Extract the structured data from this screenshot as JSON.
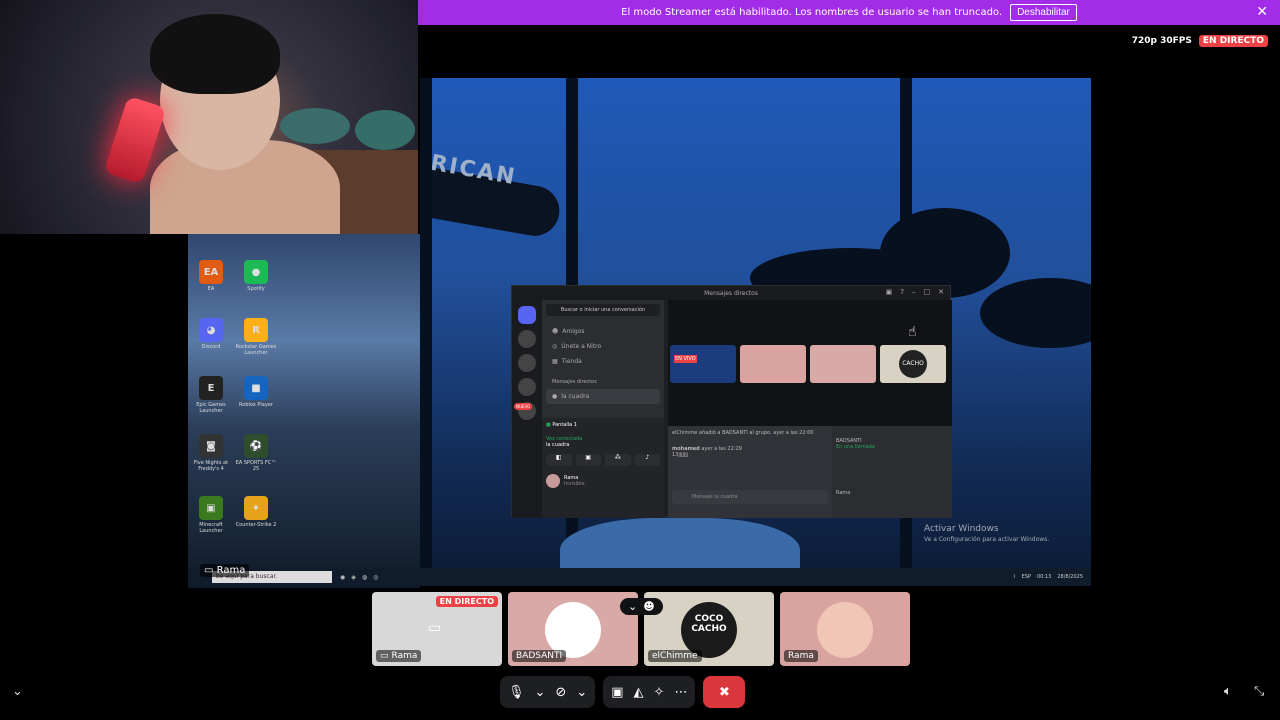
{
  "banner": {
    "text": "El modo Streamer está habilitado. Los nombres de usuario se han truncado.",
    "button": "Deshabilitar",
    "close": "✕"
  },
  "quality": {
    "label": "720p 30FPS",
    "live": "EN DIRECTO"
  },
  "stream": {
    "sign_text": "RICAN"
  },
  "activate": {
    "title": "Activar Windows",
    "sub": "Ve a Configuración para activar Windows."
  },
  "desktop_icons": [
    {
      "label": "EA",
      "color": "#e25b12"
    },
    {
      "label": "Spotify",
      "color": "#1db954"
    },
    {
      "label": "Discord",
      "color": "#5865f2"
    },
    {
      "label": "Rockstar Games Launcher",
      "color": "#fcaf17"
    },
    {
      "label": "Epic Games Launcher",
      "color": "#222222"
    },
    {
      "label": "Roblox Player",
      "color": "#1565c0"
    },
    {
      "label": "Five Nights at Freddy's 4",
      "color": "#333333"
    },
    {
      "label": "EA SPORTS FC™ 25",
      "color": "#2d4d2d"
    },
    {
      "label": "Minecraft Launcher",
      "color": "#3a7b22"
    },
    {
      "label": "Counter-Strike 2",
      "color": "#e7a21c"
    }
  ],
  "discord_window": {
    "title": "Mensajes directos",
    "search": "Buscar o iniciar una conversación",
    "nav": [
      "Amigos",
      "Únete a Nitro",
      "Tienda"
    ],
    "dm_header": "Mensajes directos",
    "dm_item": "la cuadra",
    "nuevo": "NUEVO",
    "screen": "Pantalla 1",
    "voice_connected": "Voz conectada",
    "voice_channel": "la cuadra",
    "user_name": "Rama",
    "user_status": "Invisible",
    "tile_live": "EN VIVO",
    "tile_cacho": "CACHO",
    "chat_line1": "elChimme añadió a BADSANTI al grupo.",
    "chat_line1_time": "ayer a las 22:00",
    "chat_user2": "mohamed",
    "chat_line2_time": "ayer a las 22:29",
    "chat_line2": "13jjjjjjj",
    "message_placeholder": "Mensaje la cuadra",
    "members": [
      "BADSANTI",
      "En una llamada",
      "Rama"
    ]
  },
  "taskbar": {
    "search_placeholder": "be aquí para buscar.",
    "lang": "ESP",
    "time": "00:13",
    "date": "28/8/2025"
  },
  "stream_owner": "Rama",
  "participants": [
    {
      "name": "Rama",
      "live": "EN DIRECTO",
      "bg": "#d8d8d8"
    },
    {
      "name": "BADSANTI",
      "bg": "#d9a9a7"
    },
    {
      "name": "elChimme",
      "bg": "#d7d2c4"
    },
    {
      "name": "Rama",
      "bg": "#d9a49f"
    }
  ],
  "avatars": {
    "coco_cacho": "COCO CACHO"
  },
  "icons": {
    "mic": "mic-icon",
    "camera": "camera-off-icon",
    "share": "screen-share-icon",
    "activities": "gamepad-icon",
    "soundboard": "soundboard-icon",
    "more": "more-icon",
    "hangup": "hangup-icon",
    "volume": "volume-icon",
    "fullscreen": "fullscreen-exit-icon"
  }
}
